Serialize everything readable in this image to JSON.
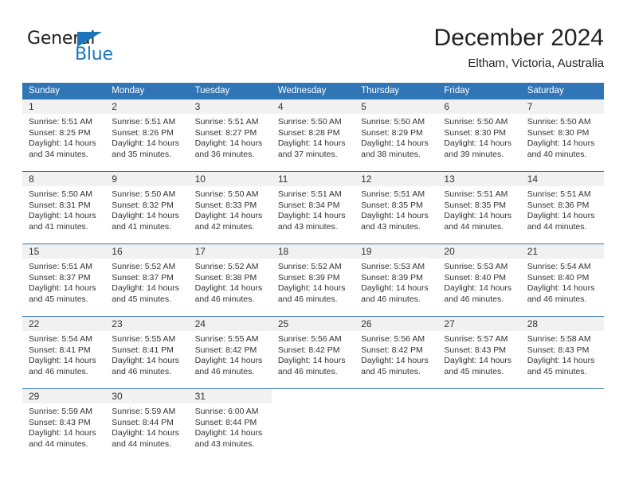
{
  "brand": {
    "name_part1": "General",
    "name_part2": "Blue",
    "triangle_icon": "triangle-icon",
    "color_black": "#231f20",
    "color_blue": "#1b75bb"
  },
  "header": {
    "month_title": "December 2024",
    "location": "Eltham, Victoria, Australia"
  },
  "theme": {
    "header_blue": "#3075b5",
    "daynum_band": "#f1f1f1",
    "text": "#333333"
  },
  "calendar": {
    "weekday_headers": [
      "Sunday",
      "Monday",
      "Tuesday",
      "Wednesday",
      "Thursday",
      "Friday",
      "Saturday"
    ],
    "weeks": [
      [
        {
          "day": "1",
          "sunrise": "Sunrise: 5:51 AM",
          "sunset": "Sunset: 8:25 PM",
          "daylight_line1": "Daylight: 14 hours",
          "daylight_line2": "and 34 minutes."
        },
        {
          "day": "2",
          "sunrise": "Sunrise: 5:51 AM",
          "sunset": "Sunset: 8:26 PM",
          "daylight_line1": "Daylight: 14 hours",
          "daylight_line2": "and 35 minutes."
        },
        {
          "day": "3",
          "sunrise": "Sunrise: 5:51 AM",
          "sunset": "Sunset: 8:27 PM",
          "daylight_line1": "Daylight: 14 hours",
          "daylight_line2": "and 36 minutes."
        },
        {
          "day": "4",
          "sunrise": "Sunrise: 5:50 AM",
          "sunset": "Sunset: 8:28 PM",
          "daylight_line1": "Daylight: 14 hours",
          "daylight_line2": "and 37 minutes."
        },
        {
          "day": "5",
          "sunrise": "Sunrise: 5:50 AM",
          "sunset": "Sunset: 8:29 PM",
          "daylight_line1": "Daylight: 14 hours",
          "daylight_line2": "and 38 minutes."
        },
        {
          "day": "6",
          "sunrise": "Sunrise: 5:50 AM",
          "sunset": "Sunset: 8:30 PM",
          "daylight_line1": "Daylight: 14 hours",
          "daylight_line2": "and 39 minutes."
        },
        {
          "day": "7",
          "sunrise": "Sunrise: 5:50 AM",
          "sunset": "Sunset: 8:30 PM",
          "daylight_line1": "Daylight: 14 hours",
          "daylight_line2": "and 40 minutes."
        }
      ],
      [
        {
          "day": "8",
          "sunrise": "Sunrise: 5:50 AM",
          "sunset": "Sunset: 8:31 PM",
          "daylight_line1": "Daylight: 14 hours",
          "daylight_line2": "and 41 minutes."
        },
        {
          "day": "9",
          "sunrise": "Sunrise: 5:50 AM",
          "sunset": "Sunset: 8:32 PM",
          "daylight_line1": "Daylight: 14 hours",
          "daylight_line2": "and 41 minutes."
        },
        {
          "day": "10",
          "sunrise": "Sunrise: 5:50 AM",
          "sunset": "Sunset: 8:33 PM",
          "daylight_line1": "Daylight: 14 hours",
          "daylight_line2": "and 42 minutes."
        },
        {
          "day": "11",
          "sunrise": "Sunrise: 5:51 AM",
          "sunset": "Sunset: 8:34 PM",
          "daylight_line1": "Daylight: 14 hours",
          "daylight_line2": "and 43 minutes."
        },
        {
          "day": "12",
          "sunrise": "Sunrise: 5:51 AM",
          "sunset": "Sunset: 8:35 PM",
          "daylight_line1": "Daylight: 14 hours",
          "daylight_line2": "and 43 minutes."
        },
        {
          "day": "13",
          "sunrise": "Sunrise: 5:51 AM",
          "sunset": "Sunset: 8:35 PM",
          "daylight_line1": "Daylight: 14 hours",
          "daylight_line2": "and 44 minutes."
        },
        {
          "day": "14",
          "sunrise": "Sunrise: 5:51 AM",
          "sunset": "Sunset: 8:36 PM",
          "daylight_line1": "Daylight: 14 hours",
          "daylight_line2": "and 44 minutes."
        }
      ],
      [
        {
          "day": "15",
          "sunrise": "Sunrise: 5:51 AM",
          "sunset": "Sunset: 8:37 PM",
          "daylight_line1": "Daylight: 14 hours",
          "daylight_line2": "and 45 minutes."
        },
        {
          "day": "16",
          "sunrise": "Sunrise: 5:52 AM",
          "sunset": "Sunset: 8:37 PM",
          "daylight_line1": "Daylight: 14 hours",
          "daylight_line2": "and 45 minutes."
        },
        {
          "day": "17",
          "sunrise": "Sunrise: 5:52 AM",
          "sunset": "Sunset: 8:38 PM",
          "daylight_line1": "Daylight: 14 hours",
          "daylight_line2": "and 46 minutes."
        },
        {
          "day": "18",
          "sunrise": "Sunrise: 5:52 AM",
          "sunset": "Sunset: 8:39 PM",
          "daylight_line1": "Daylight: 14 hours",
          "daylight_line2": "and 46 minutes."
        },
        {
          "day": "19",
          "sunrise": "Sunrise: 5:53 AM",
          "sunset": "Sunset: 8:39 PM",
          "daylight_line1": "Daylight: 14 hours",
          "daylight_line2": "and 46 minutes."
        },
        {
          "day": "20",
          "sunrise": "Sunrise: 5:53 AM",
          "sunset": "Sunset: 8:40 PM",
          "daylight_line1": "Daylight: 14 hours",
          "daylight_line2": "and 46 minutes."
        },
        {
          "day": "21",
          "sunrise": "Sunrise: 5:54 AM",
          "sunset": "Sunset: 8:40 PM",
          "daylight_line1": "Daylight: 14 hours",
          "daylight_line2": "and 46 minutes."
        }
      ],
      [
        {
          "day": "22",
          "sunrise": "Sunrise: 5:54 AM",
          "sunset": "Sunset: 8:41 PM",
          "daylight_line1": "Daylight: 14 hours",
          "daylight_line2": "and 46 minutes."
        },
        {
          "day": "23",
          "sunrise": "Sunrise: 5:55 AM",
          "sunset": "Sunset: 8:41 PM",
          "daylight_line1": "Daylight: 14 hours",
          "daylight_line2": "and 46 minutes."
        },
        {
          "day": "24",
          "sunrise": "Sunrise: 5:55 AM",
          "sunset": "Sunset: 8:42 PM",
          "daylight_line1": "Daylight: 14 hours",
          "daylight_line2": "and 46 minutes."
        },
        {
          "day": "25",
          "sunrise": "Sunrise: 5:56 AM",
          "sunset": "Sunset: 8:42 PM",
          "daylight_line1": "Daylight: 14 hours",
          "daylight_line2": "and 46 minutes."
        },
        {
          "day": "26",
          "sunrise": "Sunrise: 5:56 AM",
          "sunset": "Sunset: 8:42 PM",
          "daylight_line1": "Daylight: 14 hours",
          "daylight_line2": "and 45 minutes."
        },
        {
          "day": "27",
          "sunrise": "Sunrise: 5:57 AM",
          "sunset": "Sunset: 8:43 PM",
          "daylight_line1": "Daylight: 14 hours",
          "daylight_line2": "and 45 minutes."
        },
        {
          "day": "28",
          "sunrise": "Sunrise: 5:58 AM",
          "sunset": "Sunset: 8:43 PM",
          "daylight_line1": "Daylight: 14 hours",
          "daylight_line2": "and 45 minutes."
        }
      ],
      [
        {
          "day": "29",
          "sunrise": "Sunrise: 5:59 AM",
          "sunset": "Sunset: 8:43 PM",
          "daylight_line1": "Daylight: 14 hours",
          "daylight_line2": "and 44 minutes."
        },
        {
          "day": "30",
          "sunrise": "Sunrise: 5:59 AM",
          "sunset": "Sunset: 8:44 PM",
          "daylight_line1": "Daylight: 14 hours",
          "daylight_line2": "and 44 minutes."
        },
        {
          "day": "31",
          "sunrise": "Sunrise: 6:00 AM",
          "sunset": "Sunset: 8:44 PM",
          "daylight_line1": "Daylight: 14 hours",
          "daylight_line2": "and 43 minutes."
        },
        {
          "day": "",
          "sunrise": "",
          "sunset": "",
          "daylight_line1": "",
          "daylight_line2": ""
        },
        {
          "day": "",
          "sunrise": "",
          "sunset": "",
          "daylight_line1": "",
          "daylight_line2": ""
        },
        {
          "day": "",
          "sunrise": "",
          "sunset": "",
          "daylight_line1": "",
          "daylight_line2": ""
        },
        {
          "day": "",
          "sunrise": "",
          "sunset": "",
          "daylight_line1": "",
          "daylight_line2": ""
        }
      ]
    ]
  }
}
